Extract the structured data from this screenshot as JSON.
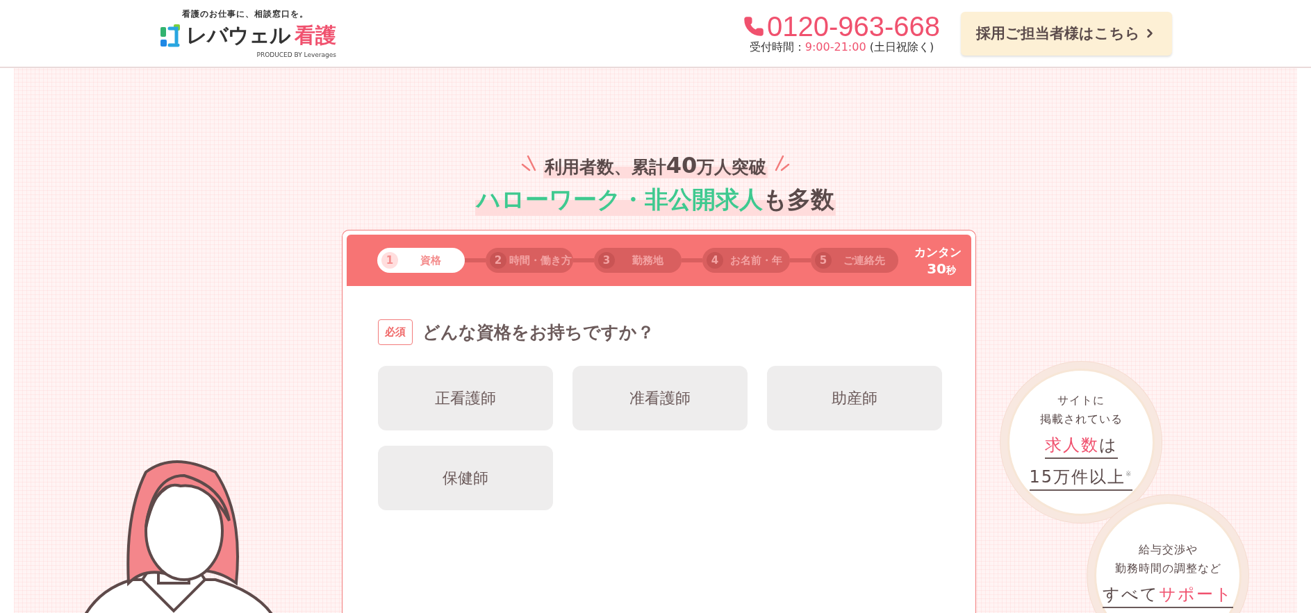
{
  "header": {
    "tagline": "看護のお仕事に、相談窓口を。",
    "logo_text": "レバウェル",
    "logo_accent": "看護",
    "logo_sub": "PRODUCED BY Leverages",
    "phone": "0120-963-668",
    "hours_label": "受付時間：",
    "hours_time": "9:00-21:00",
    "hours_note": "(土日祝除く)",
    "employer_button": "採用ご担当者様はこちら"
  },
  "hero": {
    "line1": {
      "before": "利用者数、累計",
      "number": "40",
      "after": "万人突破"
    },
    "line2": {
      "accent": "ハローワーク・非公開求人",
      "rest": "も多数"
    }
  },
  "form": {
    "steps": [
      {
        "number": "1",
        "label": "資格",
        "selected": true
      },
      {
        "number": "2",
        "label": "時間・働き方",
        "selected": false
      },
      {
        "number": "3",
        "label": "勤務地",
        "selected": false
      },
      {
        "number": "4",
        "label": "お名前・年",
        "selected": false
      },
      {
        "number": "5",
        "label": "ご連絡先",
        "selected": false
      }
    ],
    "badge": {
      "text": "カンタン",
      "time": "30",
      "unit": "秒"
    },
    "question": {
      "required": "必須",
      "text": "どんな資格をお持ちですか？"
    },
    "options": [
      {
        "label": "正看護師",
        "selected": false
      },
      {
        "label": "准看護師",
        "selected": false
      },
      {
        "label": "助産師",
        "selected": false
      },
      {
        "label": "保健師",
        "selected": false
      }
    ]
  },
  "features": [
    {
      "lines": [
        "サイトに",
        "掲載されている"
      ],
      "accent": "求人数",
      "accent_after": "は",
      "big": "15万件以上",
      "note": "※"
    },
    {
      "lines": [
        "給与交渉や",
        "勤務時間の調整など"
      ],
      "before": "すべて",
      "accent": "サポート"
    }
  ]
}
